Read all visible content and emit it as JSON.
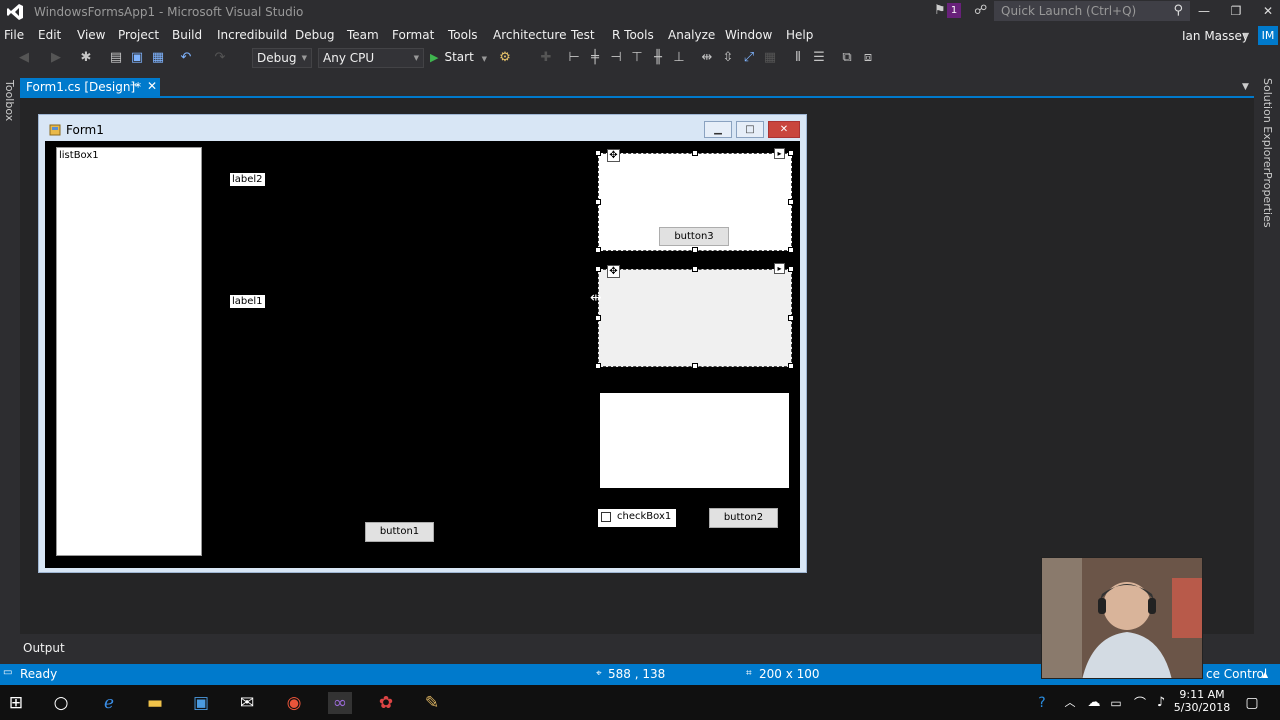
{
  "app": {
    "title": "WindowsFormsApp1 - Microsoft Visual Studio",
    "notification_count": "1",
    "quick_launch_placeholder": "Quick Launch (Ctrl+Q)",
    "user_name": "Ian Massey",
    "user_initials": "IM"
  },
  "menu": {
    "items": [
      "File",
      "Edit",
      "View",
      "Project",
      "Build",
      "Incredibuild",
      "Debug",
      "Team",
      "Format",
      "Tools",
      "Architecture",
      "Test",
      "R Tools",
      "Analyze",
      "Window",
      "Help"
    ]
  },
  "toolbar": {
    "config": "Debug",
    "platform": "Any CPU",
    "start_label": "Start"
  },
  "side_panels": {
    "left": "Toolbox",
    "right_top": "Solution Explorer",
    "right_bottom": "Properties"
  },
  "document_tab": {
    "label": "Form1.cs [Design]*"
  },
  "form": {
    "title": "Form1",
    "listbox": "listBox1",
    "label2": "label2",
    "label1": "label1",
    "button3": "button3",
    "button1": "button1",
    "button2": "button2",
    "checkbox": "checkBox1"
  },
  "output_label": "Output",
  "status": {
    "ready": "Ready",
    "position": "588 , 138",
    "size": "200 x 100",
    "source_control": "ce Control"
  },
  "taskbar": {
    "time": "9:11 AM",
    "date": "5/30/2018"
  },
  "colors": {
    "accent": "#007acc",
    "ide_background": "#2d2d30",
    "form_client": "#000000",
    "start_green": "#3fb54f"
  }
}
